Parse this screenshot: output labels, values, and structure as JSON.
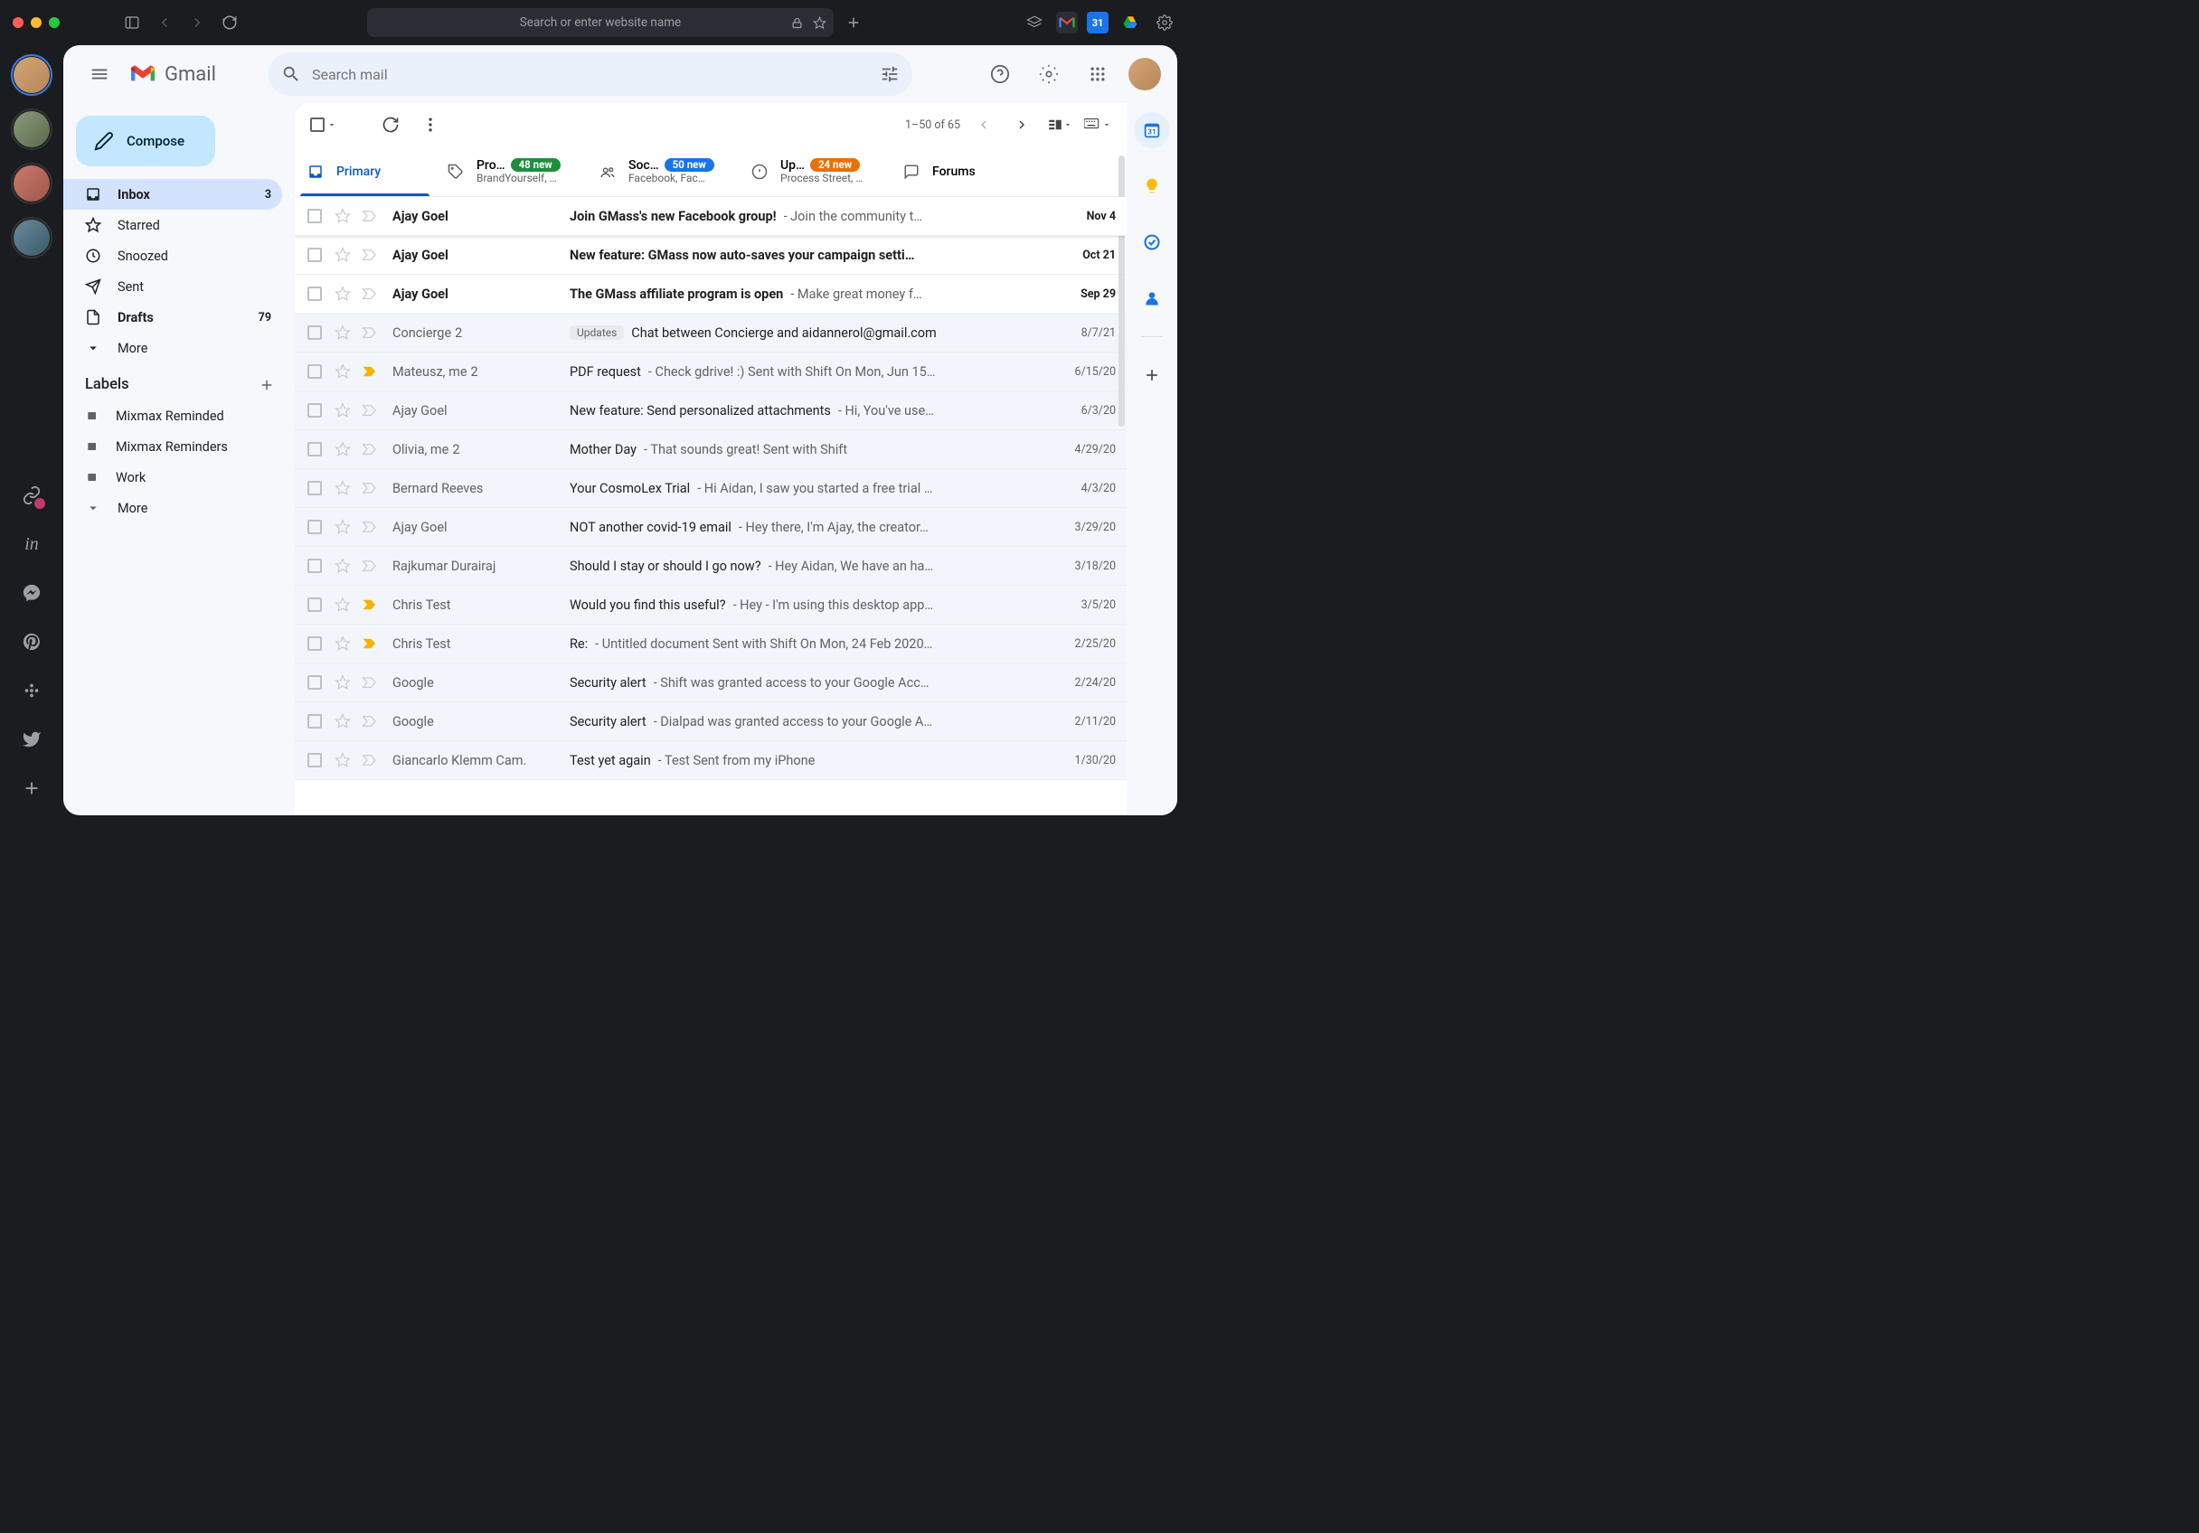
{
  "browser": {
    "url_placeholder": "Search or enter website name"
  },
  "gmail": {
    "brand": "Gmail",
    "search_placeholder": "Search mail",
    "compose_label": "Compose",
    "nav": [
      {
        "label": "Inbox",
        "count": "3",
        "active": true,
        "bold": true
      },
      {
        "label": "Starred"
      },
      {
        "label": "Snoozed"
      },
      {
        "label": "Sent"
      },
      {
        "label": "Drafts",
        "count": "79",
        "bold": true
      },
      {
        "label": "More"
      }
    ],
    "labels_header": "Labels",
    "labels": [
      {
        "label": "Mixmax Reminded"
      },
      {
        "label": "Mixmax Reminders"
      },
      {
        "label": "Work"
      },
      {
        "label": "More"
      }
    ],
    "toolbar": {
      "page_range": "1–50 of 65"
    },
    "tabs": [
      {
        "label": "Primary",
        "active": true
      },
      {
        "label": "Pro…",
        "badge": "48 new",
        "badge_color": "#1e8e3e",
        "sub": "BrandYourself, …"
      },
      {
        "label": "Soc…",
        "badge": "50 new",
        "badge_color": "#1a73e8",
        "sub": "Facebook, Fac…"
      },
      {
        "label": "Up…",
        "badge": "24 new",
        "badge_color": "#e8710a",
        "sub": "Process Street, …"
      },
      {
        "label": "Forums"
      }
    ],
    "emails": [
      {
        "sender": "Ajay Goel",
        "subject": "Join GMass's new Facebook group!",
        "snippet": " - Join the community t…",
        "date": "Nov 4",
        "unread": true
      },
      {
        "sender": "Ajay Goel",
        "subject": "New feature: GMass now auto-saves your campaign setti…",
        "snippet": "",
        "date": "Oct 21",
        "unread": true
      },
      {
        "sender": "Ajay Goel",
        "subject": "The GMass affiliate program is open",
        "snippet": " - Make great money f…",
        "date": "Sep 29",
        "unread": true
      },
      {
        "sender": "Concierge",
        "thread": "2",
        "category": "Updates",
        "subject": "Chat between Concierge and aidannerol@gmail.com",
        "snippet": "",
        "date": "8/7/21",
        "unread": false
      },
      {
        "sender": "Mateusz, me",
        "thread": "2",
        "subject": "PDF request",
        "snippet": " - Check gdrive! :) Sent with Shift On Mon, Jun 15…",
        "date": "6/15/20",
        "unread": false,
        "important": true
      },
      {
        "sender": "Ajay Goel",
        "subject": "New feature: Send personalized attachments",
        "snippet": " - Hi, You've use…",
        "date": "6/3/20",
        "unread": false
      },
      {
        "sender": "Olivia, me",
        "thread": "2",
        "subject": "Mother Day",
        "snippet": " - That sounds great! Sent with Shift",
        "date": "4/29/20",
        "unread": false
      },
      {
        "sender": "Bernard Reeves",
        "subject": "Your CosmoLex Trial",
        "snippet": " - Hi Aidan, I saw you started a free trial …",
        "date": "4/3/20",
        "unread": false
      },
      {
        "sender": "Ajay Goel",
        "subject": "NOT another covid-19 email",
        "snippet": " - Hey there, I'm Ajay, the creator…",
        "date": "3/29/20",
        "unread": false
      },
      {
        "sender": "Rajkumar Durairaj",
        "subject": "Should I stay or should I go now?",
        "snippet": " - Hey Aidan, We have an ha…",
        "date": "3/18/20",
        "unread": false
      },
      {
        "sender": "Chris Test",
        "subject": "Would you find this useful?",
        "snippet": " - Hey - I'm using this desktop app…",
        "date": "3/5/20",
        "unread": false,
        "important": true
      },
      {
        "sender": "Chris Test",
        "subject": "Re:",
        "snippet": " - Untitled document Sent with Shift On Mon, 24 Feb 2020…",
        "date": "2/25/20",
        "unread": false,
        "important": true
      },
      {
        "sender": "Google",
        "subject": "Security alert",
        "snippet": " - Shift was granted access to your Google Acc…",
        "date": "2/24/20",
        "unread": false
      },
      {
        "sender": "Google",
        "subject": "Security alert",
        "snippet": " - Dialpad was granted access to your Google A…",
        "date": "2/11/20",
        "unread": false
      },
      {
        "sender": "Giancarlo Klemm Cam.",
        "subject": "Test yet again",
        "snippet": " - Test Sent from my iPhone",
        "date": "1/30/20",
        "unread": false
      }
    ]
  }
}
